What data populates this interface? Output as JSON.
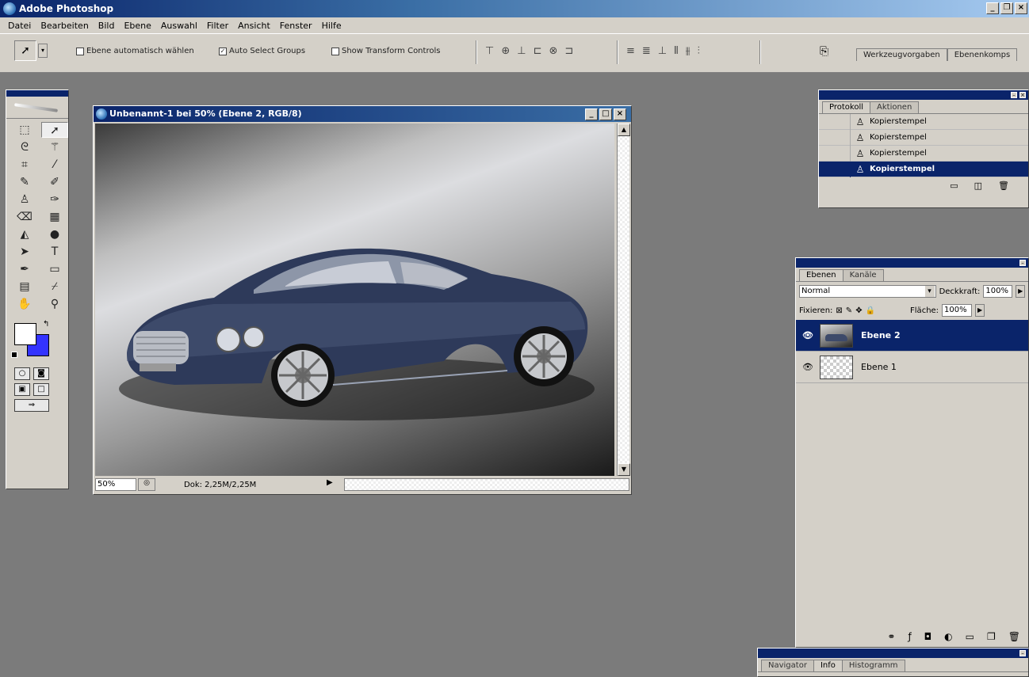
{
  "app": {
    "title": "Adobe Photoshop"
  },
  "menu": [
    "Datei",
    "Bearbeiten",
    "Bild",
    "Ebene",
    "Auswahl",
    "Filter",
    "Ansicht",
    "Fenster",
    "Hilfe"
  ],
  "options": {
    "auto_select_layer": "Ebene automatisch wählen",
    "auto_select_groups": "Auto Select Groups",
    "show_transform": "Show Transform Controls",
    "well_tabs": [
      "Werkzeugvorgaben",
      "Ebenenkomps"
    ]
  },
  "document": {
    "title": "Unbenannt-1 bei 50% (Ebene 2, RGB/8)",
    "zoom": "50%",
    "status": "Dok: 2,25M/2,25M"
  },
  "history": {
    "tabs": [
      "Protokoll",
      "Aktionen"
    ],
    "items": [
      {
        "label": "Kopierstempel",
        "selected": false
      },
      {
        "label": "Kopierstempel",
        "selected": false
      },
      {
        "label": "Kopierstempel",
        "selected": false
      },
      {
        "label": "Kopierstempel",
        "selected": true
      }
    ]
  },
  "layers": {
    "tabs": [
      "Ebenen",
      "Kanäle"
    ],
    "blend_mode": "Normal",
    "opacity_label": "Deckkraft:",
    "opacity": "100%",
    "lock_label": "Fixieren:",
    "fill_label": "Fläche:",
    "fill": "100%",
    "items": [
      {
        "name": "Ebene 2",
        "selected": true
      },
      {
        "name": "Ebene 1",
        "selected": false
      }
    ]
  },
  "navigator": {
    "tabs": [
      "Navigator",
      "Info",
      "Histogramm"
    ]
  },
  "colors": {
    "foreground": "#ffffff",
    "background": "#3333ff",
    "accent": "#0a246a"
  }
}
